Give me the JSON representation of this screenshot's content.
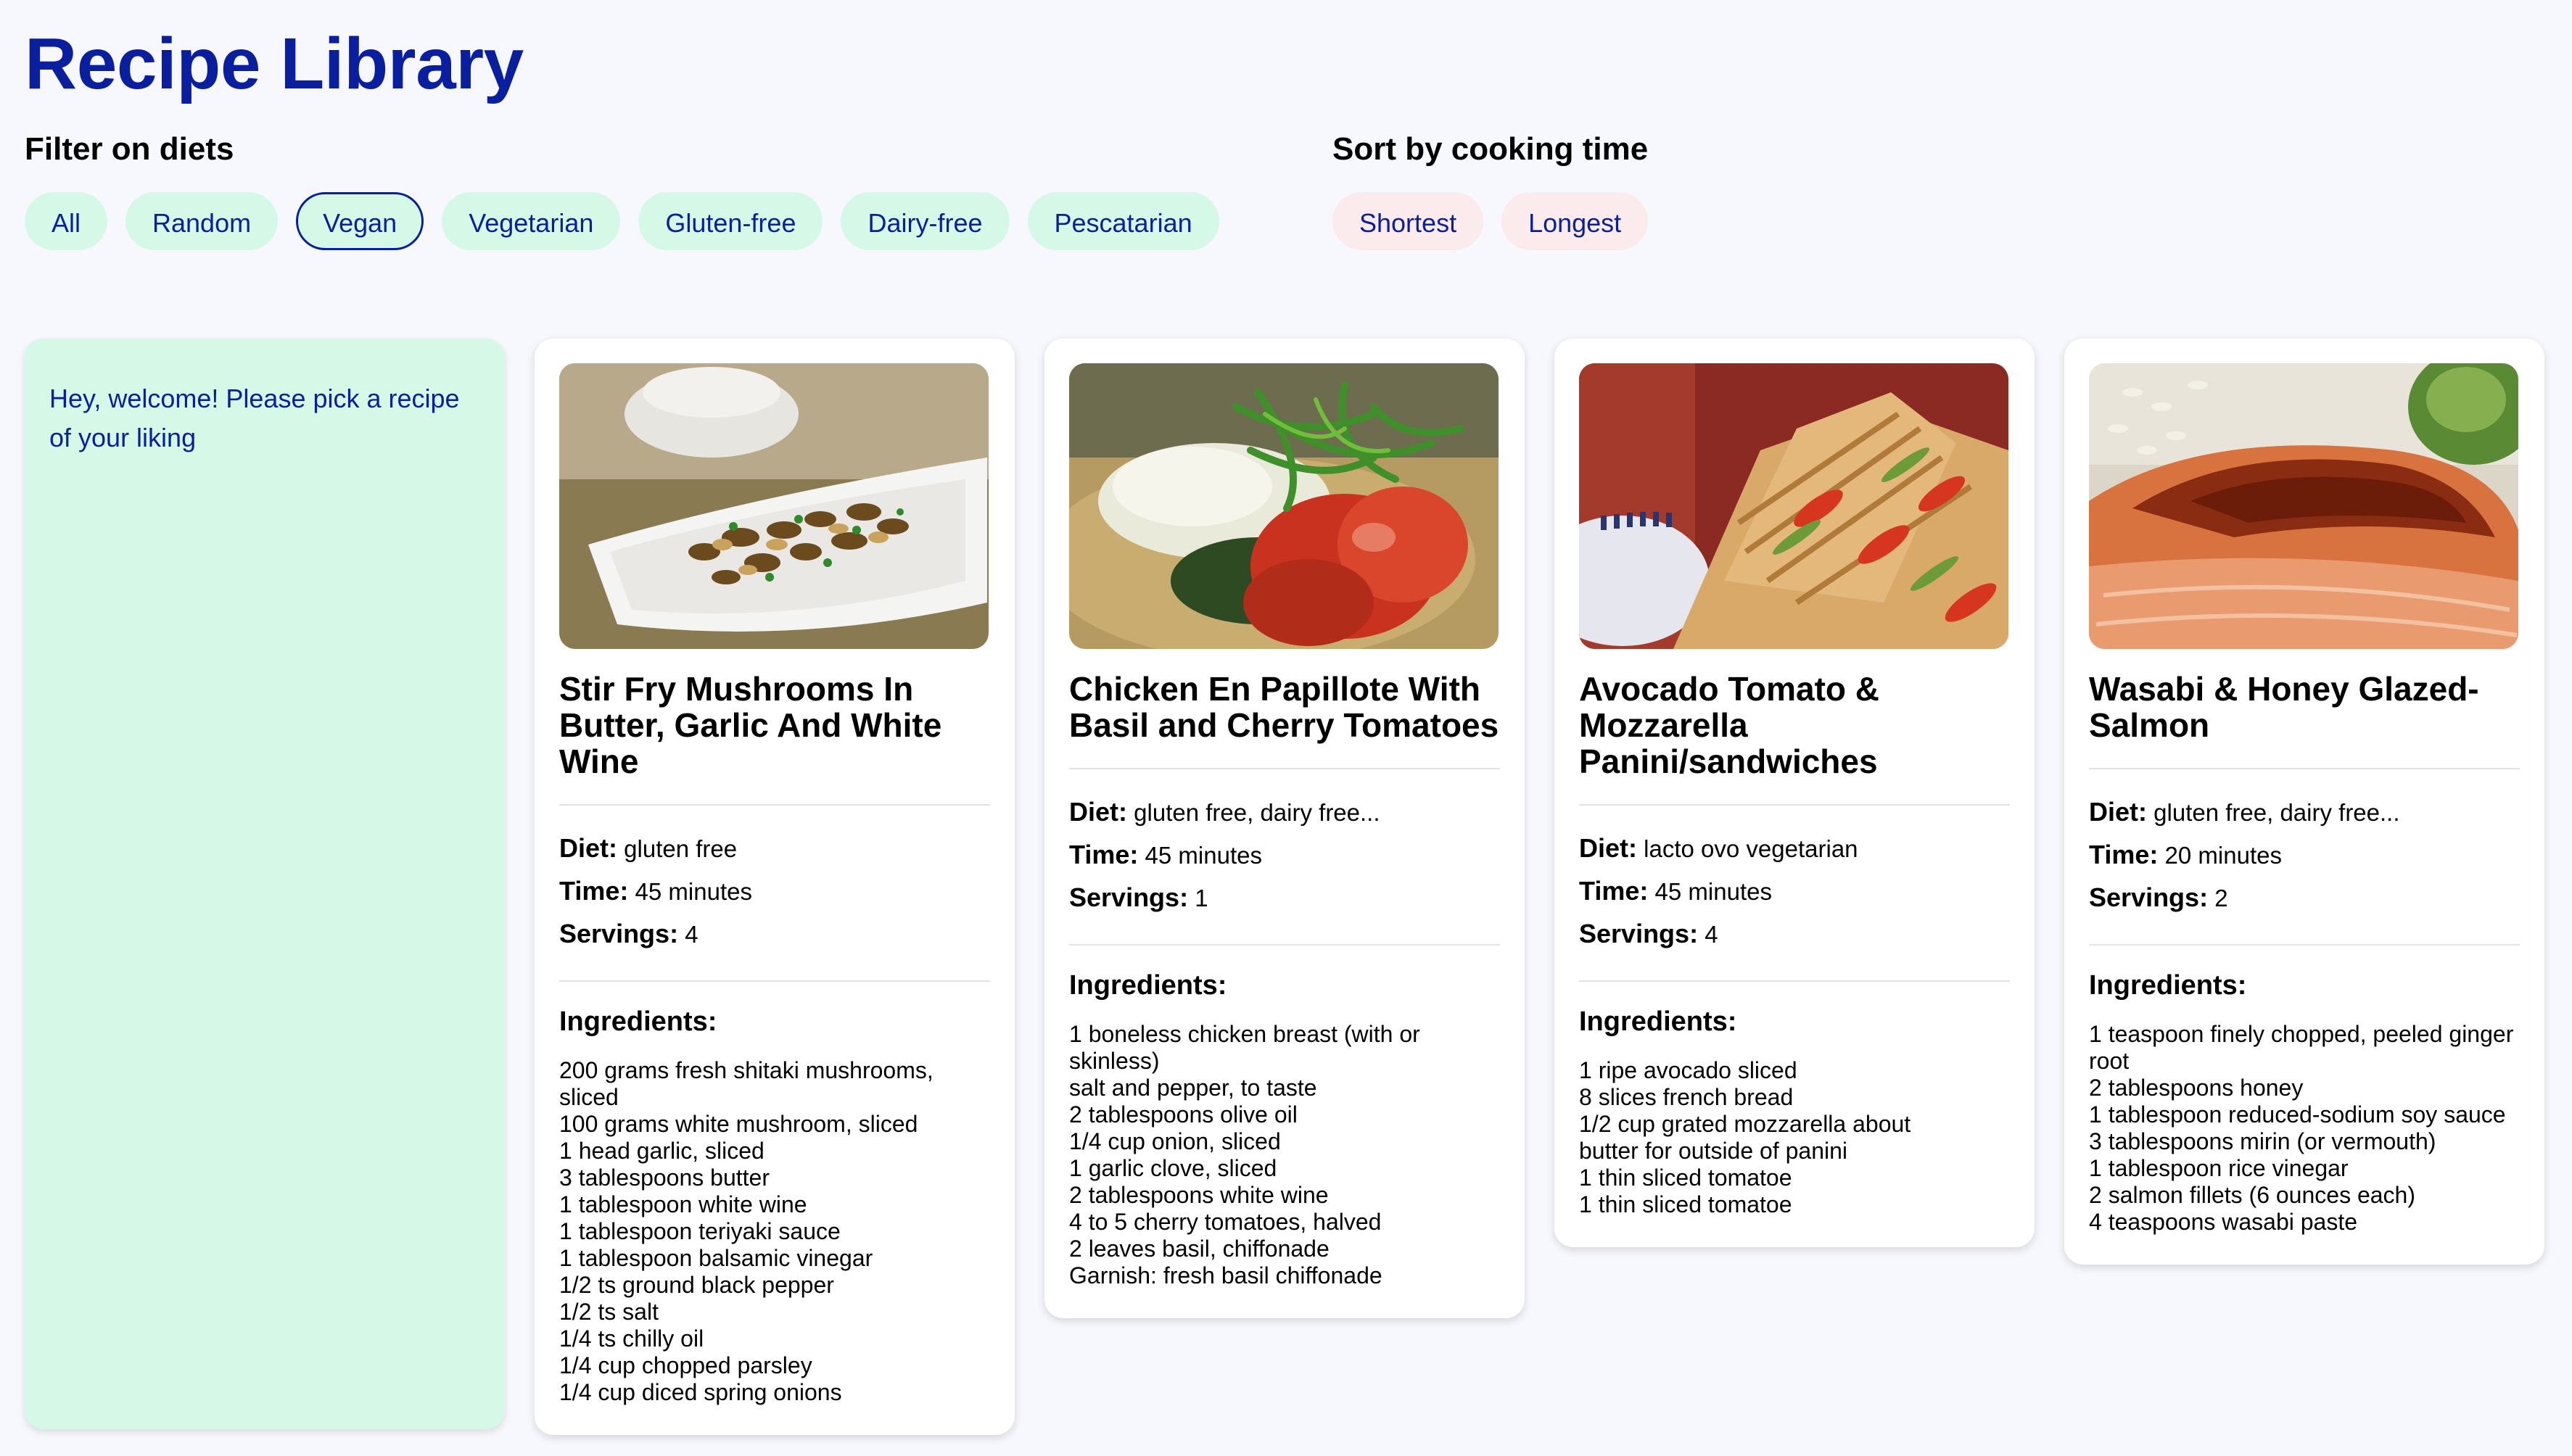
{
  "header": {
    "title": "Recipe Library"
  },
  "filters": {
    "label": "Filter on diets",
    "options": [
      "All",
      "Random",
      "Vegan",
      "Vegetarian",
      "Gluten-free",
      "Dairy-free",
      "Pescatarian"
    ],
    "selected": "Vegan"
  },
  "sort": {
    "label": "Sort by cooking time",
    "options": [
      "Shortest",
      "Longest"
    ]
  },
  "welcome": {
    "message": "Hey, welcome! Please pick a recipe of your liking"
  },
  "labels": {
    "diet": "Diet:",
    "time": "Time:",
    "servings": "Servings:",
    "ingredients": "Ingredients:"
  },
  "recipes": [
    {
      "title": "Stir Fry Mushrooms In Butter, Garlic And White Wine",
      "diet": "gluten free",
      "time": "45 minutes",
      "servings": "4",
      "image_icon": "mushroom-dish-photo",
      "ingredients": [
        "200 grams fresh shitaki mushrooms, sliced",
        "100 grams white mushroom, sliced",
        "1 head garlic, sliced",
        "3 tablespoons butter",
        "1 tablespoon white wine",
        "1 tablespoon teriyaki sauce",
        "1 tablespoon balsamic vinegar",
        "1/2 ts ground black pepper",
        "1/2 ts salt",
        "1/4 ts chilly oil",
        "1/4 cup chopped parsley",
        "1/4 cup diced spring onions"
      ]
    },
    {
      "title": "Chicken En Papillote With Basil and Cherry Tomatoes",
      "diet": "gluten free, dairy free...",
      "time": "45 minutes",
      "servings": "1",
      "image_icon": "chicken-papillote-photo",
      "ingredients": [
        "1 boneless chicken breast (with or skinless)",
        "salt and pepper, to taste",
        "2 tablespoons olive oil",
        "1/4 cup onion, sliced",
        "1 garlic clove, sliced",
        "2 tablespoons white wine",
        "4 to 5 cherry tomatoes, halved",
        "2 leaves basil, chiffonade",
        "Garnish: fresh basil chiffonade"
      ]
    },
    {
      "title": "Avocado Tomato & Mozzarella Panini/sandwiches",
      "diet": "lacto ovo vegetarian",
      "time": "45 minutes",
      "servings": "4",
      "image_icon": "panini-photo",
      "ingredients": [
        "1 ripe avocado sliced",
        "8 slices french bread",
        "1/2 cup grated mozzarella about",
        "butter for outside of panini",
        "1 thin sliced tomatoe",
        "1 thin sliced tomatoe"
      ]
    },
    {
      "title": "Wasabi & Honey Glazed-Salmon",
      "diet": "gluten free, dairy free...",
      "time": "20 minutes",
      "servings": "2",
      "image_icon": "salmon-photo",
      "ingredients": [
        "1 teaspoon finely chopped, peeled ginger root",
        "2 tablespoons honey",
        "1 tablespoon reduced-sodium soy sauce",
        "3 tablespoons mirin (or vermouth)",
        "1 tablespoon rice vinegar",
        "2 salmon fillets (6 ounces each)",
        "4 teaspoons wasabi paste"
      ]
    }
  ]
}
